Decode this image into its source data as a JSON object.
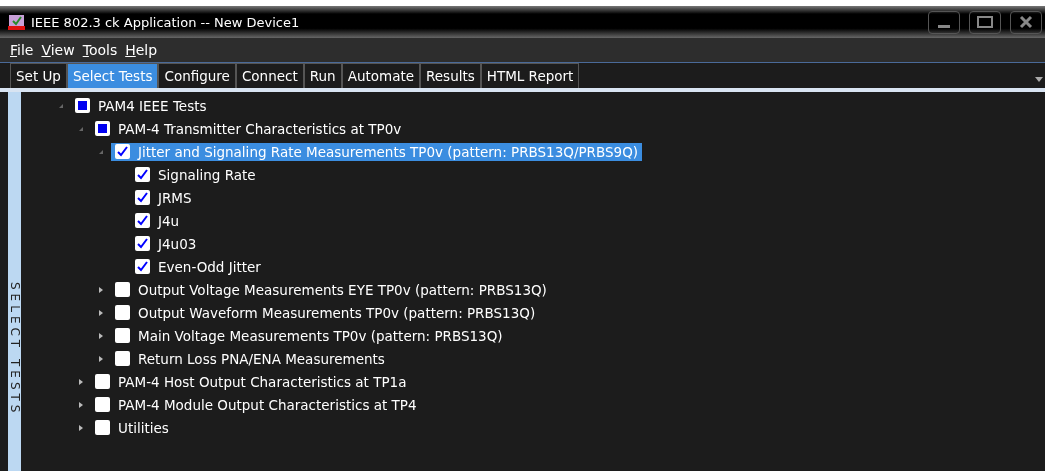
{
  "window": {
    "title": "IEEE 802.3 ck Application -- New Device1"
  },
  "menu": [
    {
      "label": "File"
    },
    {
      "label": "View"
    },
    {
      "label": "Tools"
    },
    {
      "label": "Help"
    }
  ],
  "tabs": [
    {
      "label": "Set Up",
      "selected": false
    },
    {
      "label": "Select Tests",
      "selected": true
    },
    {
      "label": "Configure",
      "selected": false
    },
    {
      "label": "Connect",
      "selected": false
    },
    {
      "label": "Run",
      "selected": false
    },
    {
      "label": "Automate",
      "selected": false
    },
    {
      "label": "Results",
      "selected": false
    },
    {
      "label": "HTML Report",
      "selected": false
    }
  ],
  "side_label": "SELECT TESTS",
  "tree": [
    {
      "label": "PAM4 IEEE Tests",
      "checked": false,
      "partial": true,
      "selected": false,
      "expanded": true,
      "children": [
        {
          "label": "PAM-4 Transmitter Characteristics at TP0v",
          "checked": false,
          "partial": true,
          "selected": false,
          "expanded": true,
          "children": [
            {
              "label": "Jitter and Signaling Rate Measurements TP0v (pattern: PRBS13Q/PRBS9Q)",
              "checked": true,
              "selected": true,
              "expanded": true,
              "children": [
                {
                  "label": "Signaling Rate",
                  "checked": true,
                  "selected": false
                },
                {
                  "label": "JRMS",
                  "checked": true,
                  "selected": false
                },
                {
                  "label": "J4u",
                  "checked": true,
                  "selected": false
                },
                {
                  "label": "J4u03",
                  "checked": true,
                  "selected": false
                },
                {
                  "label": "Even-Odd Jitter",
                  "checked": true,
                  "selected": false
                }
              ]
            },
            {
              "label": "Output Voltage Measurements EYE TP0v (pattern: PRBS13Q)",
              "checked": false,
              "selected": false,
              "expanded": false
            },
            {
              "label": "Output Waveform Measurements TP0v (pattern: PRBS13Q)",
              "checked": false,
              "selected": false,
              "expanded": false
            },
            {
              "label": "Main Voltage Measurements TP0v (pattern: PRBS13Q)",
              "checked": false,
              "selected": false,
              "expanded": false
            },
            {
              "label": "Return Loss PNA/ENA Measurements",
              "checked": false,
              "selected": false,
              "expanded": false
            }
          ]
        },
        {
          "label": "PAM-4 Host Output Characteristics at TP1a",
          "checked": false,
          "selected": false,
          "expanded": false
        },
        {
          "label": "PAM-4 Module Output Characteristics at TP4",
          "checked": false,
          "selected": false,
          "expanded": false
        },
        {
          "label": "Utilities",
          "checked": false,
          "selected": false,
          "expanded": false
        }
      ]
    }
  ]
}
